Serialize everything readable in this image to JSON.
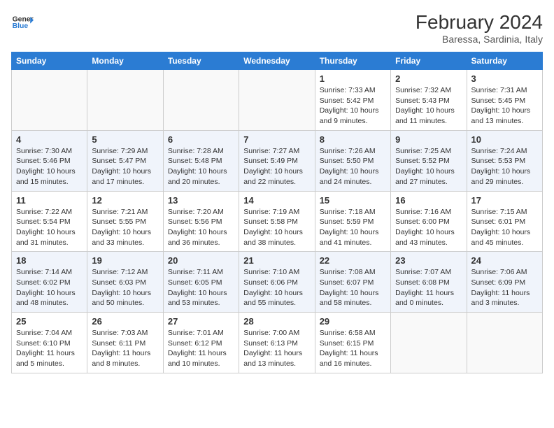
{
  "header": {
    "logo_line1": "General",
    "logo_line2": "Blue",
    "title": "February 2024",
    "subtitle": "Baressa, Sardinia, Italy"
  },
  "columns": [
    "Sunday",
    "Monday",
    "Tuesday",
    "Wednesday",
    "Thursday",
    "Friday",
    "Saturday"
  ],
  "weeks": [
    [
      {
        "day": "",
        "empty": true
      },
      {
        "day": "",
        "empty": true
      },
      {
        "day": "",
        "empty": true
      },
      {
        "day": "",
        "empty": true
      },
      {
        "day": "1",
        "sunrise": "7:33 AM",
        "sunset": "5:42 PM",
        "daylight": "10 hours and 9 minutes."
      },
      {
        "day": "2",
        "sunrise": "7:32 AM",
        "sunset": "5:43 PM",
        "daylight": "10 hours and 11 minutes."
      },
      {
        "day": "3",
        "sunrise": "7:31 AM",
        "sunset": "5:45 PM",
        "daylight": "10 hours and 13 minutes."
      }
    ],
    [
      {
        "day": "4",
        "sunrise": "7:30 AM",
        "sunset": "5:46 PM",
        "daylight": "10 hours and 15 minutes."
      },
      {
        "day": "5",
        "sunrise": "7:29 AM",
        "sunset": "5:47 PM",
        "daylight": "10 hours and 17 minutes."
      },
      {
        "day": "6",
        "sunrise": "7:28 AM",
        "sunset": "5:48 PM",
        "daylight": "10 hours and 20 minutes."
      },
      {
        "day": "7",
        "sunrise": "7:27 AM",
        "sunset": "5:49 PM",
        "daylight": "10 hours and 22 minutes."
      },
      {
        "day": "8",
        "sunrise": "7:26 AM",
        "sunset": "5:50 PM",
        "daylight": "10 hours and 24 minutes."
      },
      {
        "day": "9",
        "sunrise": "7:25 AM",
        "sunset": "5:52 PM",
        "daylight": "10 hours and 27 minutes."
      },
      {
        "day": "10",
        "sunrise": "7:24 AM",
        "sunset": "5:53 PM",
        "daylight": "10 hours and 29 minutes."
      }
    ],
    [
      {
        "day": "11",
        "sunrise": "7:22 AM",
        "sunset": "5:54 PM",
        "daylight": "10 hours and 31 minutes."
      },
      {
        "day": "12",
        "sunrise": "7:21 AM",
        "sunset": "5:55 PM",
        "daylight": "10 hours and 33 minutes."
      },
      {
        "day": "13",
        "sunrise": "7:20 AM",
        "sunset": "5:56 PM",
        "daylight": "10 hours and 36 minutes."
      },
      {
        "day": "14",
        "sunrise": "7:19 AM",
        "sunset": "5:58 PM",
        "daylight": "10 hours and 38 minutes."
      },
      {
        "day": "15",
        "sunrise": "7:18 AM",
        "sunset": "5:59 PM",
        "daylight": "10 hours and 41 minutes."
      },
      {
        "day": "16",
        "sunrise": "7:16 AM",
        "sunset": "6:00 PM",
        "daylight": "10 hours and 43 minutes."
      },
      {
        "day": "17",
        "sunrise": "7:15 AM",
        "sunset": "6:01 PM",
        "daylight": "10 hours and 45 minutes."
      }
    ],
    [
      {
        "day": "18",
        "sunrise": "7:14 AM",
        "sunset": "6:02 PM",
        "daylight": "10 hours and 48 minutes."
      },
      {
        "day": "19",
        "sunrise": "7:12 AM",
        "sunset": "6:03 PM",
        "daylight": "10 hours and 50 minutes."
      },
      {
        "day": "20",
        "sunrise": "7:11 AM",
        "sunset": "6:05 PM",
        "daylight": "10 hours and 53 minutes."
      },
      {
        "day": "21",
        "sunrise": "7:10 AM",
        "sunset": "6:06 PM",
        "daylight": "10 hours and 55 minutes."
      },
      {
        "day": "22",
        "sunrise": "7:08 AM",
        "sunset": "6:07 PM",
        "daylight": "10 hours and 58 minutes."
      },
      {
        "day": "23",
        "sunrise": "7:07 AM",
        "sunset": "6:08 PM",
        "daylight": "11 hours and 0 minutes."
      },
      {
        "day": "24",
        "sunrise": "7:06 AM",
        "sunset": "6:09 PM",
        "daylight": "11 hours and 3 minutes."
      }
    ],
    [
      {
        "day": "25",
        "sunrise": "7:04 AM",
        "sunset": "6:10 PM",
        "daylight": "11 hours and 5 minutes."
      },
      {
        "day": "26",
        "sunrise": "7:03 AM",
        "sunset": "6:11 PM",
        "daylight": "11 hours and 8 minutes."
      },
      {
        "day": "27",
        "sunrise": "7:01 AM",
        "sunset": "6:12 PM",
        "daylight": "11 hours and 10 minutes."
      },
      {
        "day": "28",
        "sunrise": "7:00 AM",
        "sunset": "6:13 PM",
        "daylight": "11 hours and 13 minutes."
      },
      {
        "day": "29",
        "sunrise": "6:58 AM",
        "sunset": "6:15 PM",
        "daylight": "11 hours and 16 minutes."
      },
      {
        "day": "",
        "empty": true
      },
      {
        "day": "",
        "empty": true
      }
    ]
  ],
  "labels": {
    "sunrise_prefix": "Sunrise: ",
    "sunset_prefix": "Sunset: ",
    "daylight_prefix": "Daylight: "
  }
}
